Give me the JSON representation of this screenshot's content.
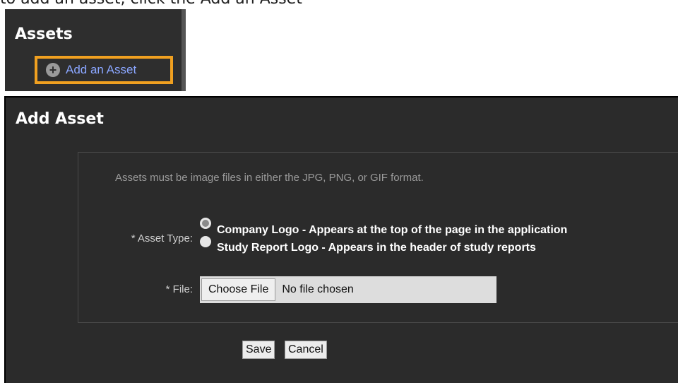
{
  "tutorial_caption": "to add an asset, click the Add an Asset",
  "sidebar": {
    "heading": "Assets",
    "add_link_label": "Add an Asset",
    "add_link_icon": "plus-circle-icon"
  },
  "dialog": {
    "title": "Add Asset",
    "info": "Assets must be image files in either the JPG, PNG, or GIF format.",
    "asset_type_label": "* Asset Type:",
    "options": [
      {
        "label": "Company Logo - Appears at the top of the page in the application",
        "checked": true
      },
      {
        "label": "Study Report Logo - Appears in the header of study reports",
        "checked": false
      }
    ],
    "file_label": "* File:",
    "choose_file_label": "Choose File",
    "file_status": "No file chosen",
    "save_label": "Save",
    "cancel_label": "Cancel"
  },
  "colors": {
    "panel_bg": "#2b2b2b",
    "highlight": "#f0a020",
    "link": "#8aa6ff"
  }
}
